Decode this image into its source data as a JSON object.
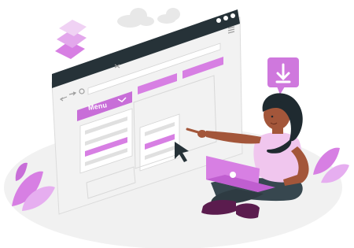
{
  "browser": {
    "menu_label": "Menu",
    "icons": [
      "back-arrow-icon",
      "forward-arrow-icon",
      "refresh-icon",
      "close-icon",
      "hamburger-icon"
    ]
  },
  "download_badge": {
    "icon": "download-arrow-icon"
  },
  "colors": {
    "accent": "#c86ed8",
    "accent_light": "#e9c2ef",
    "frame_dark": "#263238",
    "window_bg": "#f2f2f2",
    "skin": "#a3563a",
    "hair": "#1f2a30",
    "pants": "#37474f",
    "top": "#f0c6ee",
    "floor": "#f1f1f1"
  }
}
